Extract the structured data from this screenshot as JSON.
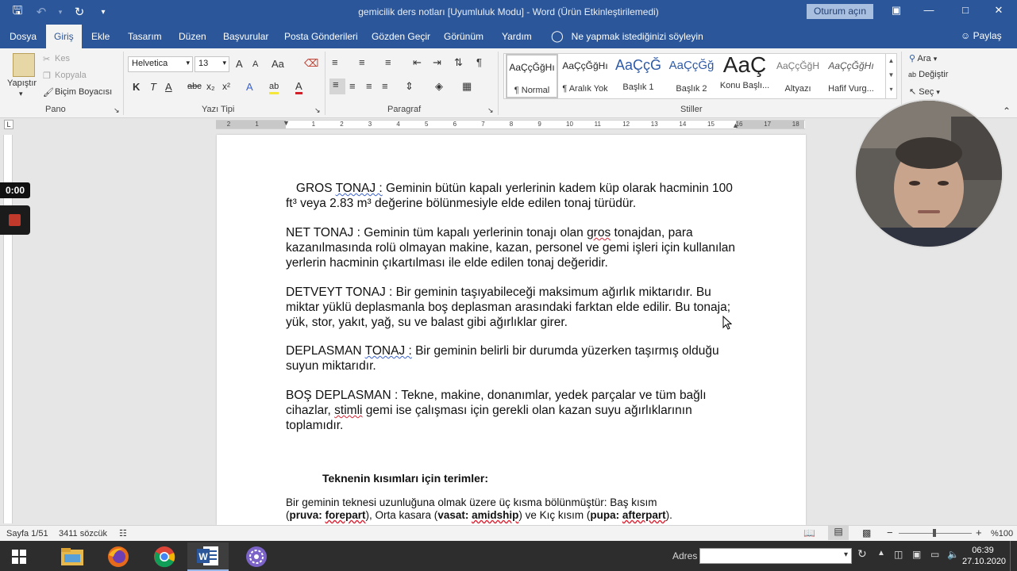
{
  "window": {
    "title": "gemicilik ders notları [Uyumluluk Modu]  -  Word (Ürün Etkinleştirilemedi)",
    "signin_label": "Oturum açın"
  },
  "tabs": [
    "Dosya",
    "Giriş",
    "Ekle",
    "Tasarım",
    "Düzen",
    "Başvurular",
    "Posta Gönderileri",
    "Gözden Geçir",
    "Görünüm",
    "Yardım"
  ],
  "tell_me": "Ne yapmak istediğinizi söyleyin",
  "share_label": "Paylaş",
  "clipboard": {
    "paste": "Yapıştır",
    "cut": "Kes",
    "copy": "Kopyala",
    "format_painter": "Biçim Boyacısı",
    "label": "Pano"
  },
  "font": {
    "name": "Helvetica",
    "size": "13",
    "label": "Yazı Tipi",
    "grow": "A",
    "shrink": "A",
    "case": "Aa",
    "bold": "K",
    "italic": "T",
    "underline": "A",
    "strike": "abc",
    "subscript": "x₂",
    "superscript": "x²",
    "effects": "A",
    "highlight": "ab",
    "color": "A"
  },
  "paragraph": {
    "label": "Paragraf"
  },
  "styles": {
    "label": "Stiller",
    "items": [
      {
        "sample": "AaÇçĞğHı",
        "name": "¶ Normal"
      },
      {
        "sample": "AaÇçĞğHı",
        "name": "¶ Aralık Yok"
      },
      {
        "sample": "AaÇçĞ",
        "name": "Başlık 1"
      },
      {
        "sample": "AaÇçĞğ",
        "name": "Başlık 2"
      },
      {
        "sample": "AaÇ",
        "name": "Konu Başlı..."
      },
      {
        "sample": "AaÇçĞğH",
        "name": "Altyazı"
      },
      {
        "sample": "AaÇçĞğHı",
        "name": "Hafif Vurg..."
      }
    ]
  },
  "editing": {
    "find": "Ara",
    "replace": "Değiştir",
    "select": "Seç"
  },
  "ruler": {
    "marks": [
      "2",
      "1",
      "1",
      "2",
      "3",
      "4",
      "5",
      "6",
      "7",
      "8",
      "9",
      "10",
      "11",
      "12",
      "13",
      "14",
      "15",
      "16",
      "17",
      "18"
    ]
  },
  "document": {
    "p1": {
      "pre": "   GROS ",
      "term": "TONAJ :",
      "rest": " Geminin bütün kapalı yerlerinin kadem küp olarak hacminin 100 ft³ veya 2.83 m³ değerine bölünmesiyle elde edilen tonaj türüdür."
    },
    "p2": {
      "pre": "NET TONAJ : Geminin tüm kapalı yerlerinin tonajı olan ",
      "err": "gros",
      "rest": " tonajdan, para kazanılmasında rolü olmayan makine, kazan, personel ve gemi işleri için kullanılan yerlerin hacminin çıkartılması ile elde edilen tonaj değeridir."
    },
    "p3": "DETVEYT TONAJ : Bir geminin taşıyabileceği maksimum ağırlık miktarıdır. Bu miktar yüklü deplasmanla boş deplasman arasındaki farktan elde edilir. Bu tonaja; yük, stor, yakıt, yağ, su ve balast gibi ağırlıklar girer.",
    "p4": {
      "pre": "DEPLASMAN ",
      "term": "TONAJ :",
      "rest": " Bir geminin belirli bir durumda yüzerken taşırmış olduğu suyun miktarıdır."
    },
    "p5": {
      "pre": "BOŞ DEPLASMAN : Tekne, makine, donanımlar, yedek parçalar ve tüm bağlı cihazlar, ",
      "err": "stimli",
      "rest": " gemi ise çalışması için gerekli olan kazan suyu ağırlıklarının toplamıdır."
    },
    "heading": "Teknenin kısımları için terimler:",
    "p6": {
      "line1": "Bir geminin teknesi uzunluğuna olmak üzere üç kısma bölünmüştür: Baş kısım",
      "open1": "(",
      "b1": "pruva: ",
      "b1e": "forepart",
      "t1": "), Orta kasara (",
      "b2": "vasat: ",
      "b2e": "amidship",
      "t2": ") ve Kıç kısım (",
      "b3": "pupa: ",
      "b3e": "afterpart",
      "t3": ")."
    }
  },
  "recording": {
    "time": "0:00"
  },
  "status": {
    "page": "Sayfa 1/51",
    "words": "3411 sözcük",
    "zoom": "%100"
  },
  "taskbar": {
    "address_label": "Adres",
    "time": "06:39",
    "date": "27.10.2020"
  }
}
